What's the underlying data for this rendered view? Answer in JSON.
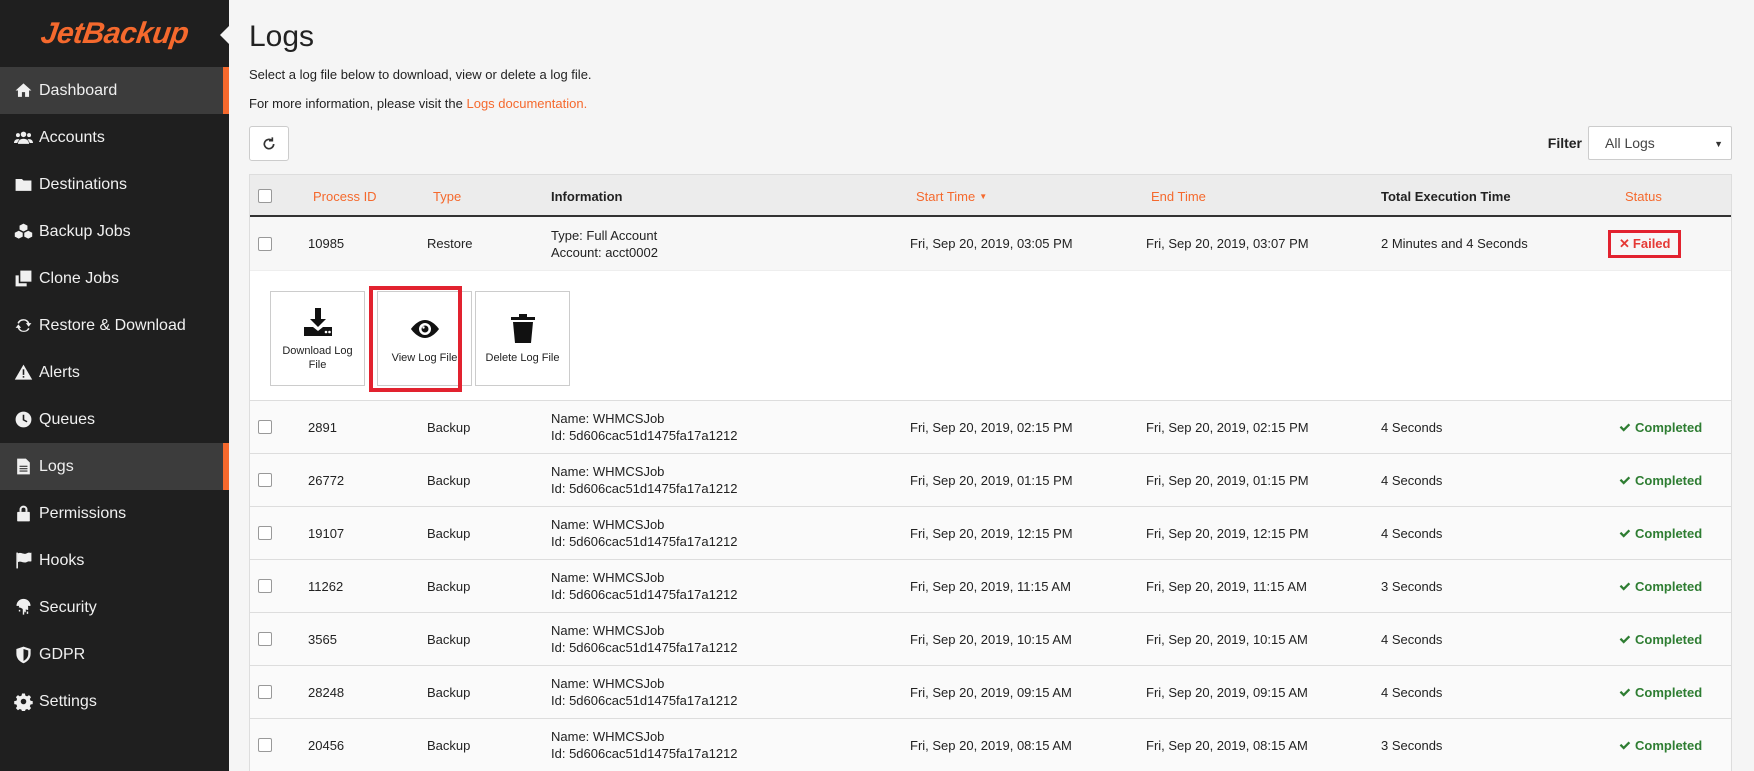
{
  "brand": {
    "name": "JetBackup"
  },
  "sidebar": {
    "items": [
      {
        "label": "Dashboard",
        "icon": "home-icon",
        "active": true
      },
      {
        "label": "Accounts",
        "icon": "users-icon",
        "active": false
      },
      {
        "label": "Destinations",
        "icon": "folder-icon",
        "active": false
      },
      {
        "label": "Backup Jobs",
        "icon": "cubes-icon",
        "active": false
      },
      {
        "label": "Clone Jobs",
        "icon": "clone-icon",
        "active": false
      },
      {
        "label": "Restore & Download",
        "icon": "refresh-icon",
        "active": false
      },
      {
        "label": "Alerts",
        "icon": "warning-icon",
        "active": false
      },
      {
        "label": "Queues",
        "icon": "clock-icon",
        "active": false
      },
      {
        "label": "Logs",
        "icon": "file-icon",
        "active": true
      },
      {
        "label": "Permissions",
        "icon": "lock-icon",
        "active": false
      },
      {
        "label": "Hooks",
        "icon": "flag-icon",
        "active": false
      },
      {
        "label": "Security",
        "icon": "fingerprint-icon",
        "active": false
      },
      {
        "label": "GDPR",
        "icon": "shield-icon",
        "active": false
      },
      {
        "label": "Settings",
        "icon": "gear-icon",
        "active": false
      }
    ]
  },
  "page": {
    "title": "Logs",
    "description": "Select a log file below to download, view or delete a log file.",
    "more_info_prefix": "For more information, please visit the ",
    "more_info_link": "Logs documentation."
  },
  "filter": {
    "label": "Filter",
    "selected": "All Logs"
  },
  "table": {
    "columns": {
      "process_id": "Process ID",
      "type": "Type",
      "information": "Information",
      "start_time": "Start Time",
      "end_time": "End Time",
      "total_execution_time": "Total Execution Time",
      "status": "Status"
    },
    "rows": [
      {
        "process_id": "10985",
        "type": "Restore",
        "info1": "Type: Full Account",
        "info2": "Account: acct0002",
        "start": "Fri, Sep 20, 2019, 03:05 PM",
        "end": "Fri, Sep 20, 2019, 03:07 PM",
        "exec": "2 Minutes and 4 Seconds",
        "status": "Failed"
      },
      {
        "process_id": "2891",
        "type": "Backup",
        "info1": "Name: WHMCSJob",
        "info2": "Id: 5d606cac51d1475fa17a1212",
        "start": "Fri, Sep 20, 2019, 02:15 PM",
        "end": "Fri, Sep 20, 2019, 02:15 PM",
        "exec": "4 Seconds",
        "status": "Completed"
      },
      {
        "process_id": "26772",
        "type": "Backup",
        "info1": "Name: WHMCSJob",
        "info2": "Id: 5d606cac51d1475fa17a1212",
        "start": "Fri, Sep 20, 2019, 01:15 PM",
        "end": "Fri, Sep 20, 2019, 01:15 PM",
        "exec": "4 Seconds",
        "status": "Completed"
      },
      {
        "process_id": "19107",
        "type": "Backup",
        "info1": "Name: WHMCSJob",
        "info2": "Id: 5d606cac51d1475fa17a1212",
        "start": "Fri, Sep 20, 2019, 12:15 PM",
        "end": "Fri, Sep 20, 2019, 12:15 PM",
        "exec": "4 Seconds",
        "status": "Completed"
      },
      {
        "process_id": "11262",
        "type": "Backup",
        "info1": "Name: WHMCSJob",
        "info2": "Id: 5d606cac51d1475fa17a1212",
        "start": "Fri, Sep 20, 2019, 11:15 AM",
        "end": "Fri, Sep 20, 2019, 11:15 AM",
        "exec": "3 Seconds",
        "status": "Completed"
      },
      {
        "process_id": "3565",
        "type": "Backup",
        "info1": "Name: WHMCSJob",
        "info2": "Id: 5d606cac51d1475fa17a1212",
        "start": "Fri, Sep 20, 2019, 10:15 AM",
        "end": "Fri, Sep 20, 2019, 10:15 AM",
        "exec": "4 Seconds",
        "status": "Completed"
      },
      {
        "process_id": "28248",
        "type": "Backup",
        "info1": "Name: WHMCSJob",
        "info2": "Id: 5d606cac51d1475fa17a1212",
        "start": "Fri, Sep 20, 2019, 09:15 AM",
        "end": "Fri, Sep 20, 2019, 09:15 AM",
        "exec": "4 Seconds",
        "status": "Completed"
      },
      {
        "process_id": "20456",
        "type": "Backup",
        "info1": "Name: WHMCSJob",
        "info2": "Id: 5d606cac51d1475fa17a1212",
        "start": "Fri, Sep 20, 2019, 08:15 AM",
        "end": "Fri, Sep 20, 2019, 08:15 AM",
        "exec": "3 Seconds",
        "status": "Completed"
      }
    ]
  },
  "actions": {
    "download": "Download Log File",
    "view": "View Log File",
    "delete": "Delete Log File"
  },
  "colors": {
    "accent": "#f5692d",
    "sidebar_bg": "#1f1f1f",
    "completed": "#2e7d32",
    "failed": "#e53935",
    "highlight": "#e2222f"
  }
}
